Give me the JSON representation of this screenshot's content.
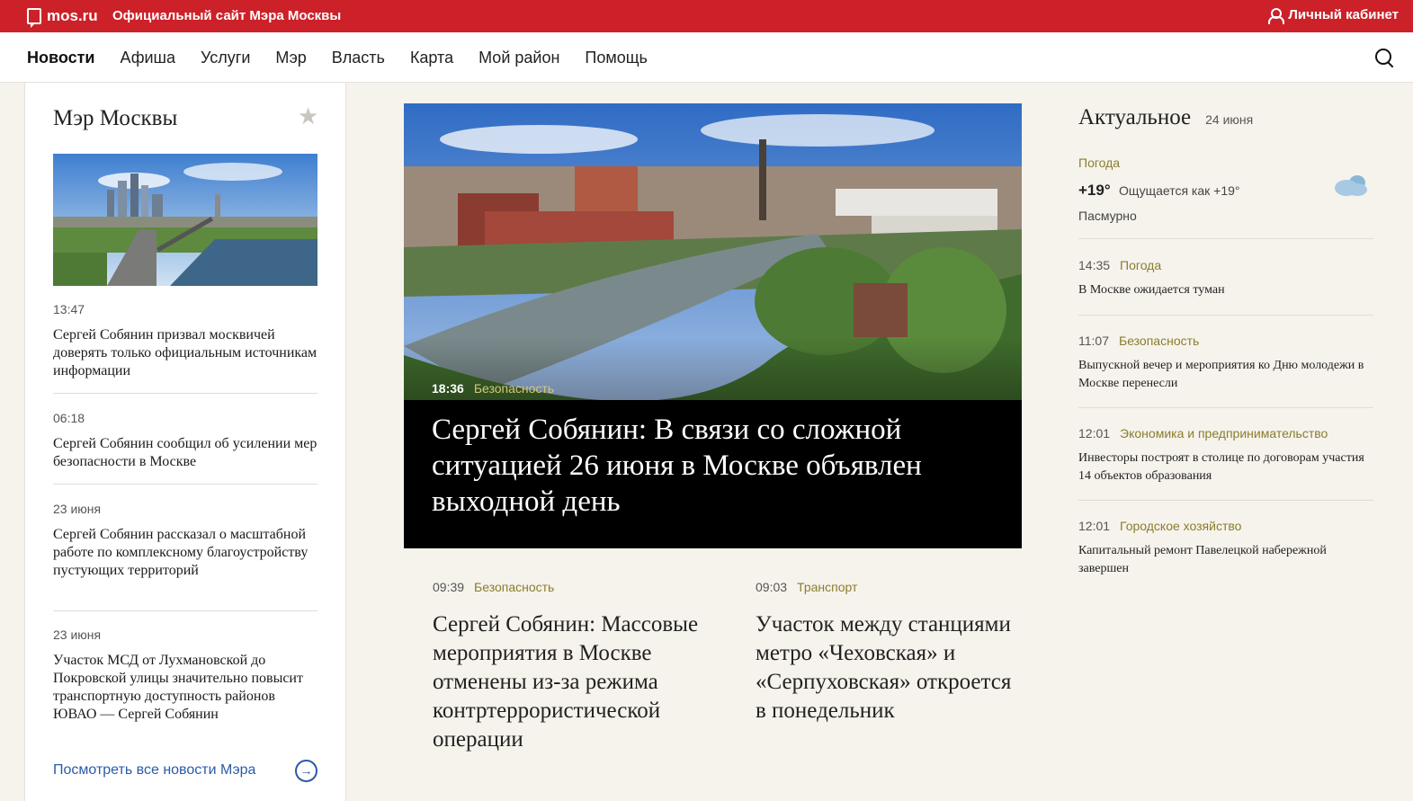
{
  "topbar": {
    "logo": "mos.ru",
    "site_title": "Официальный сайт Мэра Москвы",
    "cabinet": "Личный кабинет",
    "color": "#cc2129"
  },
  "nav": {
    "items": [
      "Новости",
      "Афиша",
      "Услуги",
      "Мэр",
      "Власть",
      "Карта",
      "Мой район",
      "Помощь"
    ],
    "active": "Новости"
  },
  "left_panel": {
    "title": "Мэр Москвы",
    "news": [
      {
        "time": "13:47",
        "text": "Сергей Собянин призвал москвичей доверять только официальным источникам информации"
      },
      {
        "time": "06:18",
        "text": "Сергей Собянин сообщил об усилении мер безопасности в Москве"
      },
      {
        "time": "23 июня",
        "text": "Сергей Собянин рассказал о масштабной работе по комплексному благоустройству пустующих территорий"
      },
      {
        "time": "23 июня",
        "text": "Участок МСД от Лухмановской до Покровской улицы значительно повысит транспортную доступность районов ЮВАО — Сергей Собянин"
      }
    ],
    "all_link": "Посмотреть все новости Мэра"
  },
  "hero": {
    "time": "18:36",
    "category": "Безопасность",
    "title": "Сергей Собянин: В связи со сложной ситуацией 26 июня в Москве объявлен выходной день"
  },
  "sub_news": [
    {
      "time": "09:39",
      "category": "Безопасность",
      "title": "Сергей Собянин: Массовые мероприятия в Москве отменены из-за режима контртеррористической операции"
    },
    {
      "time": "09:03",
      "category": "Транспорт",
      "title": "Участок между станциями метро «Чеховская» и «Серпуховская» откроется в понедельник"
    }
  ],
  "right_panel": {
    "title": "Актуальное",
    "date": "24 июня",
    "weather": {
      "label": "Погода",
      "temp": "+19°",
      "feels": "Ощущается как +19°",
      "desc": "Пасмурно"
    },
    "items": [
      {
        "time": "14:35",
        "category": "Погода",
        "text": "В Москве ожидается туман"
      },
      {
        "time": "11:07",
        "category": "Безопасность",
        "text": "Выпускной вечер и мероприятия ко Дню молодежи в Москве перенесли"
      },
      {
        "time": "12:01",
        "category": "Экономика и предпринимательство",
        "text": "Инвесторы построят в столице по договорам участия 14 объектов образования"
      },
      {
        "time": "12:01",
        "category": "Городское хозяйство",
        "text": "Капитальный ремонт Павелецкой набережной завершен"
      }
    ]
  }
}
